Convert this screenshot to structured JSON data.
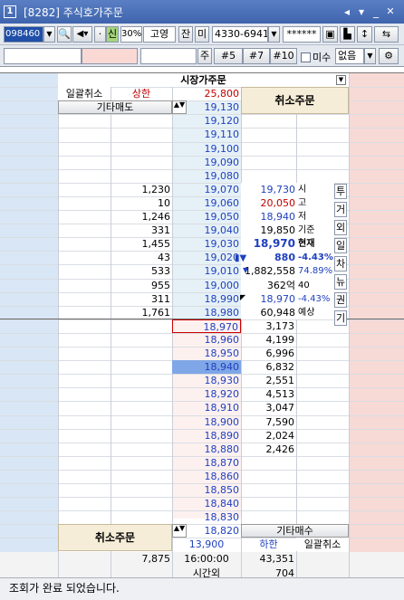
{
  "window": {
    "num": "1",
    "title": "[8282] 주식호가주문"
  },
  "toolbar": {
    "code": "098460",
    "signal": "신",
    "margin_rate": "30%",
    "stock_name": "고영",
    "jan_label": "잔",
    "mi_label": "미",
    "account": "4330-6941",
    "password": "******",
    "ju_label": "주",
    "qty_5": "#5",
    "qty_7": "#7",
    "qty_10": "#10",
    "misu_label": "미수",
    "option_value": "없음"
  },
  "market_order_label": "시장가주문",
  "left_header": {
    "bulk_cancel": "일괄취소",
    "upper_limit_label": "상한",
    "upper_limit_price": "25,800",
    "other_sell": "기타매도",
    "cancel_order": "취소주문"
  },
  "sell_prices": [
    "19,130",
    "19,120",
    "19,110",
    "19,100",
    "19,090",
    "19,080",
    "19,070",
    "19,060",
    "19,050",
    "19,040",
    "19,030",
    "19,020",
    "19,010",
    "19,000",
    "18,990",
    "18,980"
  ],
  "sell_qty": [
    "",
    "",
    "",
    "",
    "",
    "",
    "1,230",
    "10",
    "1,246",
    "331",
    "1,455",
    "43",
    "533",
    "955",
    "311",
    "1,761"
  ],
  "buy_prices": [
    "18,970",
    "18,960",
    "18,950",
    "18,940",
    "18,930",
    "18,920",
    "18,910",
    "18,900",
    "18,890",
    "18,880",
    "18,870",
    "18,860",
    "18,850",
    "18,840",
    "18,830",
    "18,820"
  ],
  "buy_qty": [
    "3,173",
    "4,199",
    "6,996",
    "6,832",
    "2,551",
    "4,513",
    "3,047",
    "7,590",
    "2,024",
    "2,426",
    "",
    "",
    "",
    "",
    "",
    ""
  ],
  "info": {
    "open": "19,730",
    "open_label": "시",
    "high": "20,050",
    "high_label": "고",
    "low": "18,940",
    "low_label": "저",
    "base": "19,850",
    "base_label": "기준",
    "current": "18,970",
    "current_label": "현재",
    "change": "880",
    "change_pct": "-4.43%",
    "volume": "1,882,558",
    "volume_pct": "74.89%",
    "days": "362억",
    "days_value": "40",
    "exp_price": "18,970",
    "exp_pct": "-4.43%",
    "exp_volume": "60,948",
    "exp_label": "예상"
  },
  "side_buttons": [
    "투",
    "거",
    "외",
    "일",
    "차",
    "뉴",
    "권",
    "기"
  ],
  "right_header": {
    "cancel_order": "취소주문"
  },
  "bottom": {
    "cancel_order": "취소주문",
    "other_buy": "기타매수",
    "lower_limit_price": "13,900",
    "lower_limit_label": "하한",
    "bulk_cancel": "일괄취소",
    "total_sell": "7,875",
    "time": "16:00:00",
    "total_buy": "43,351",
    "after_hours": "시간외",
    "after_hours_qty": "704"
  },
  "status": "조회가 완료 되었습니다.",
  "colors": {
    "sell_bg": "#d9e6f5",
    "buy_bg": "#f7d9d6",
    "price_bg": "#e5f1f6",
    "up": "#c00000",
    "down": "#1f3fbf"
  }
}
